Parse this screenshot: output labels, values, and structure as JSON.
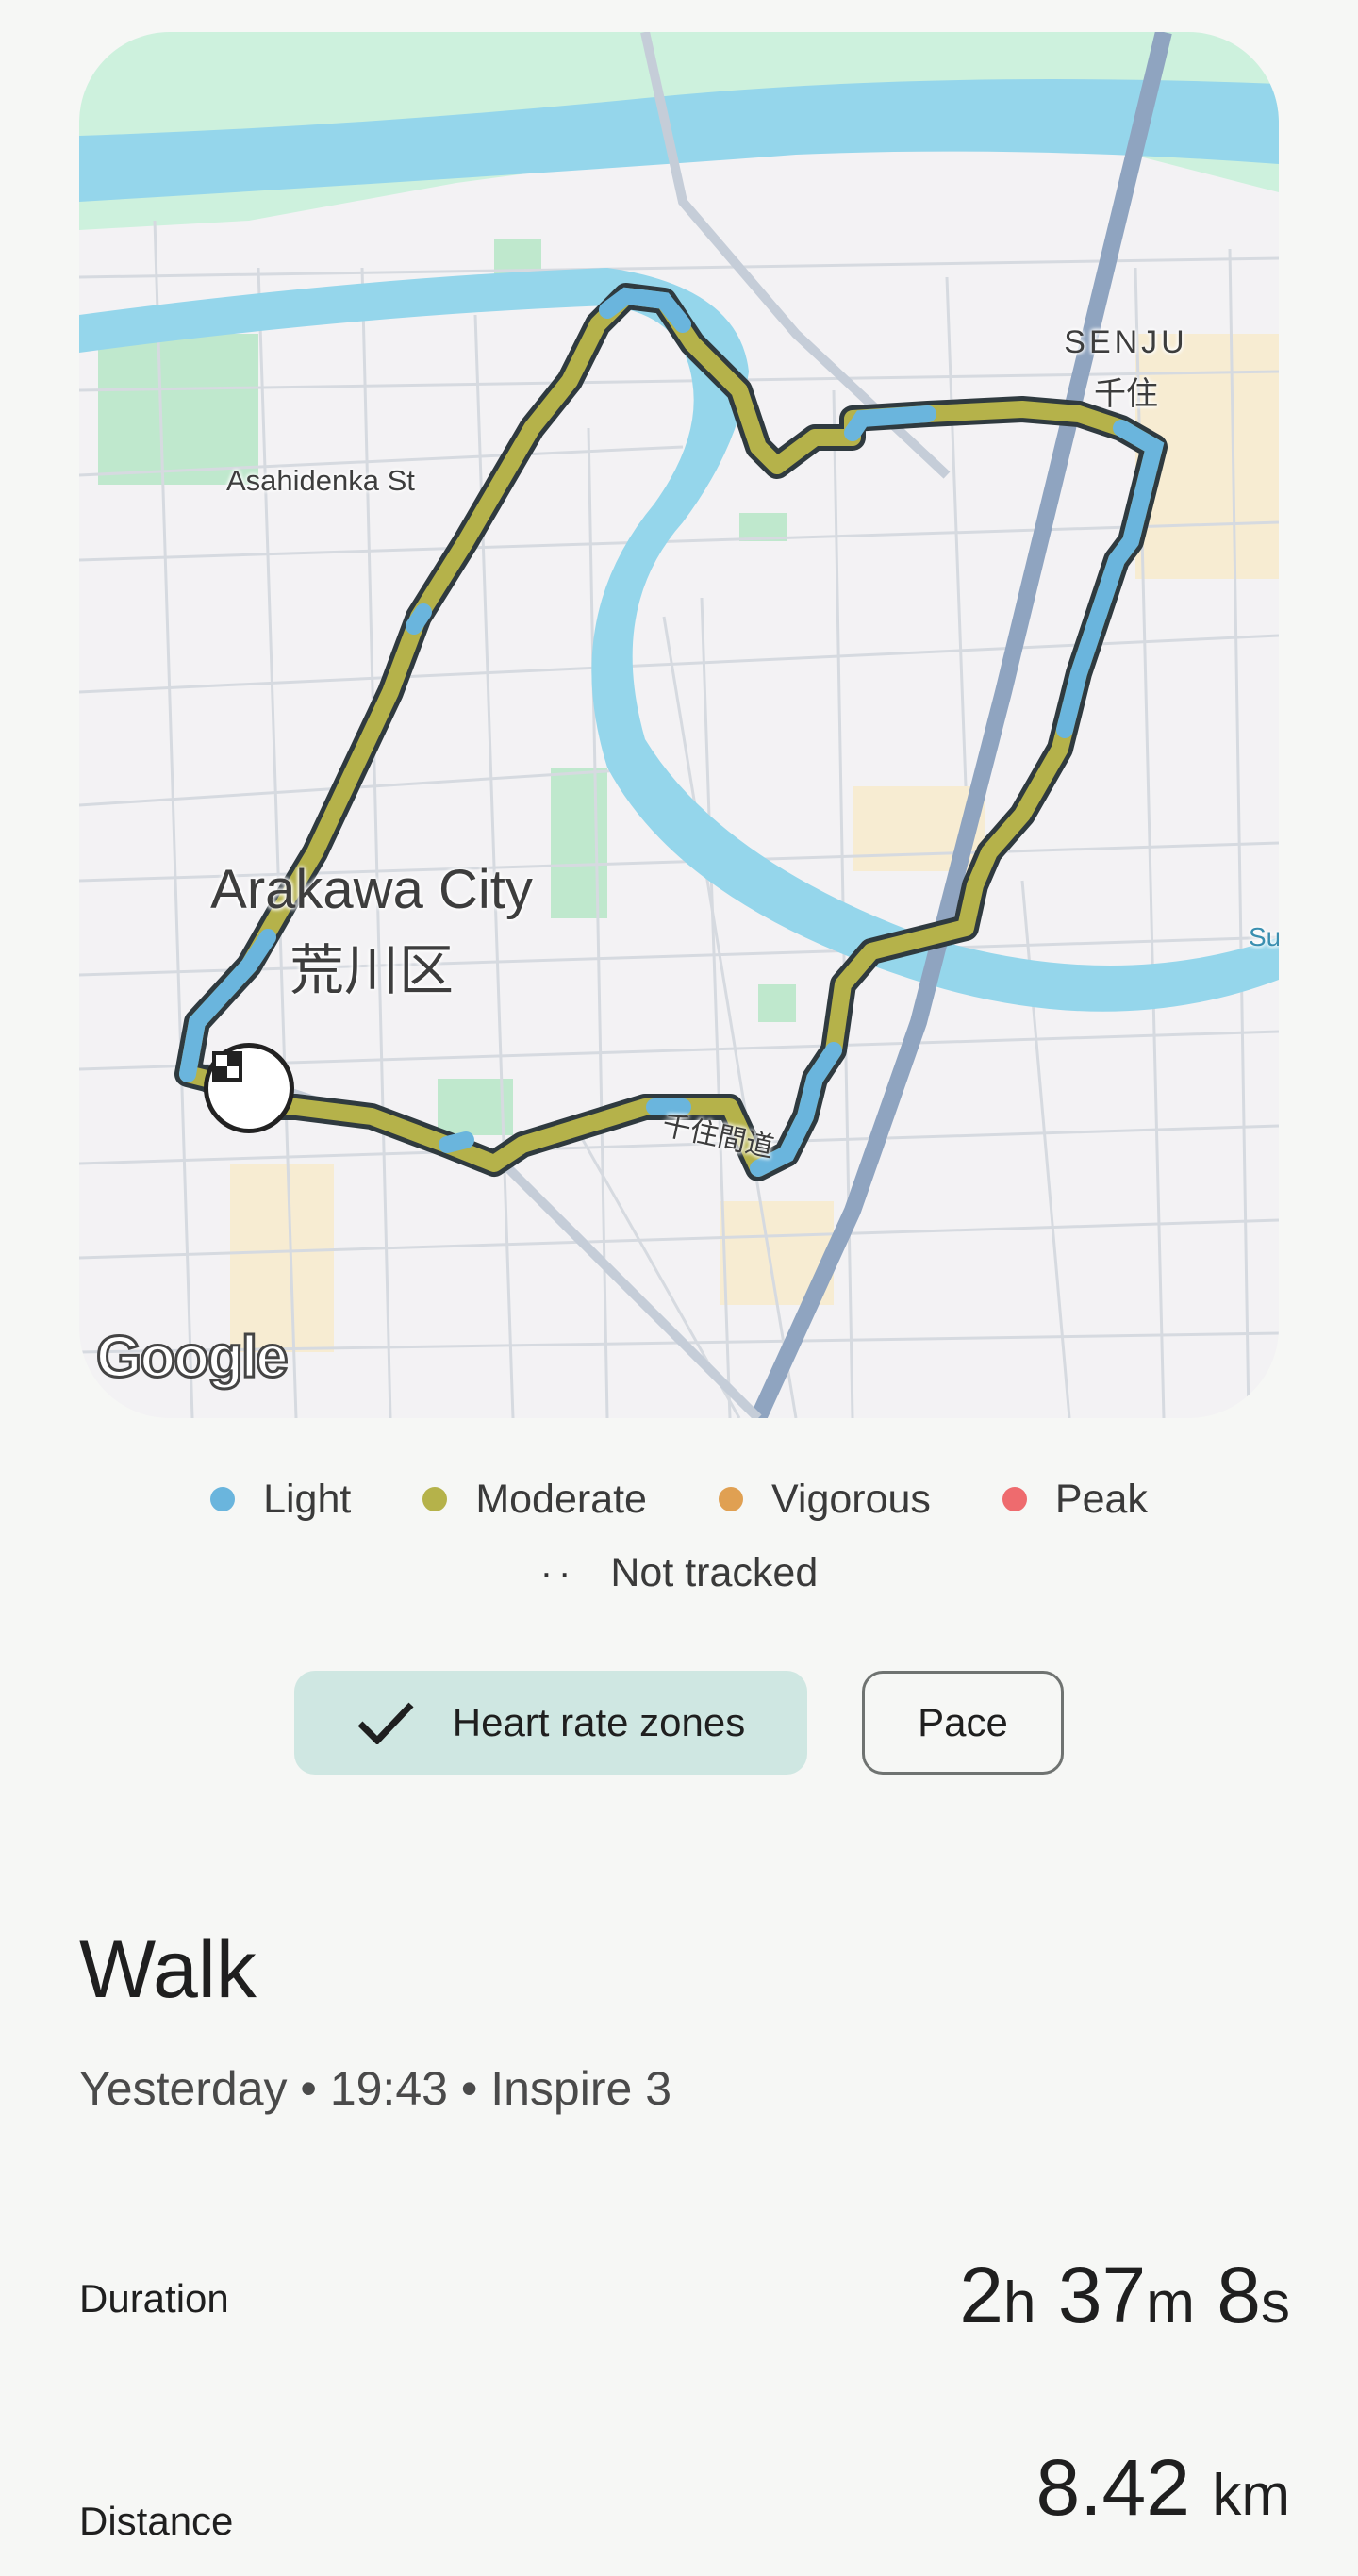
{
  "map": {
    "labels": {
      "street": "Asahidenka St",
      "district_en": "Arakawa City",
      "district_ja": "荒川区",
      "senju_en": "SENJU",
      "senju_ja": "千住",
      "road": "千住間道",
      "edge": "Su"
    },
    "attribution": "Google",
    "start_marker_icon": "finish-flag-icon"
  },
  "legend": {
    "items": [
      {
        "label": "Light",
        "color": "#6ab5dd"
      },
      {
        "label": "Moderate",
        "color": "#b5b24a"
      },
      {
        "label": "Vigorous",
        "color": "#e0a052"
      },
      {
        "label": "Peak",
        "color": "#ee6b6e"
      }
    ],
    "not_tracked": "Not tracked"
  },
  "toggles": {
    "heart_rate_zones": "Heart rate zones",
    "pace": "Pace"
  },
  "activity": {
    "title": "Walk",
    "subtitle": "Yesterday • 19:43 • Inspire 3"
  },
  "stats": {
    "duration": {
      "label": "Duration",
      "h": "2",
      "h_unit": "h",
      "m": "37",
      "m_unit": "m",
      "s": "8",
      "s_unit": "s"
    },
    "distance": {
      "label": "Distance",
      "value": "8.42",
      "unit": "km"
    }
  }
}
